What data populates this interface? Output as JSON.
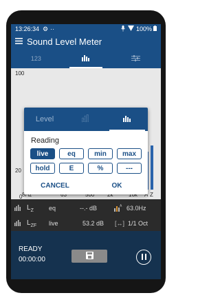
{
  "statusbar": {
    "time": "13:26:34",
    "icons": [
      "gear-icon",
      "dots-icon",
      "mic-icon",
      "wifi-icon"
    ],
    "battery": "100%"
  },
  "appbar": {
    "menu_icon": "hamburger-icon",
    "title": "Sound Level Meter"
  },
  "tabs": [
    {
      "label": "123",
      "active": false
    },
    {
      "label": "",
      "icon": "spectrum-bars-icon",
      "active": true
    },
    {
      "label": "",
      "icon": "sliders-icon",
      "active": false
    }
  ],
  "chart": {
    "y_ticks": [
      "100",
      "20",
      "0"
    ],
    "x_ticks": [
      "8Hz",
      "63",
      "500",
      "2k",
      "16k",
      "A",
      "Z"
    ]
  },
  "chart_data": {
    "type": "bar",
    "categories": [
      "8Hz",
      "63",
      "500",
      "2k",
      "16k",
      "A",
      "Z"
    ],
    "ylim": [
      0,
      100
    ],
    "ylabel": "",
    "xlabel": "",
    "bars_count": 16,
    "highlighted_band": "63",
    "bar_color": "#2a64ad",
    "highlight_color": "#d99433"
  },
  "dialog": {
    "tabs": [
      {
        "label": "Level",
        "active": false
      },
      {
        "label": "",
        "icon": "octave-bars-icon",
        "active": false
      },
      {
        "label": "",
        "icon": "spectrum-bars-icon",
        "active": true
      }
    ],
    "title": "Reading",
    "options": [
      {
        "label": "live",
        "selected": true
      },
      {
        "label": "eq",
        "selected": false
      },
      {
        "label": "min",
        "selected": false
      },
      {
        "label": "max",
        "selected": false
      },
      {
        "label": "hold",
        "selected": false
      },
      {
        "label": "E",
        "selected": false
      },
      {
        "label": "%",
        "selected": false
      },
      {
        "label": "---",
        "selected": false
      }
    ],
    "cancel": "CANCEL",
    "ok": "OK"
  },
  "panel": {
    "row1": {
      "label1": "L",
      "label1_sub": "Z",
      "label2": "eq",
      "value": "--.- dB",
      "right_value": "63.0Hz",
      "right_icon_label": "A"
    },
    "row2": {
      "label1": "L",
      "label1_sub": "ZF",
      "label2": "live",
      "value": "53.2 dB",
      "right_value": "1/1 Oct",
      "right_icon": "bracket-arrows-icon"
    }
  },
  "bottom": {
    "status": "READY",
    "timer": "00:00:00"
  },
  "colors": {
    "primary": "#1a4f86",
    "highlight": "#d99433",
    "panel": "#2b2b2b"
  }
}
